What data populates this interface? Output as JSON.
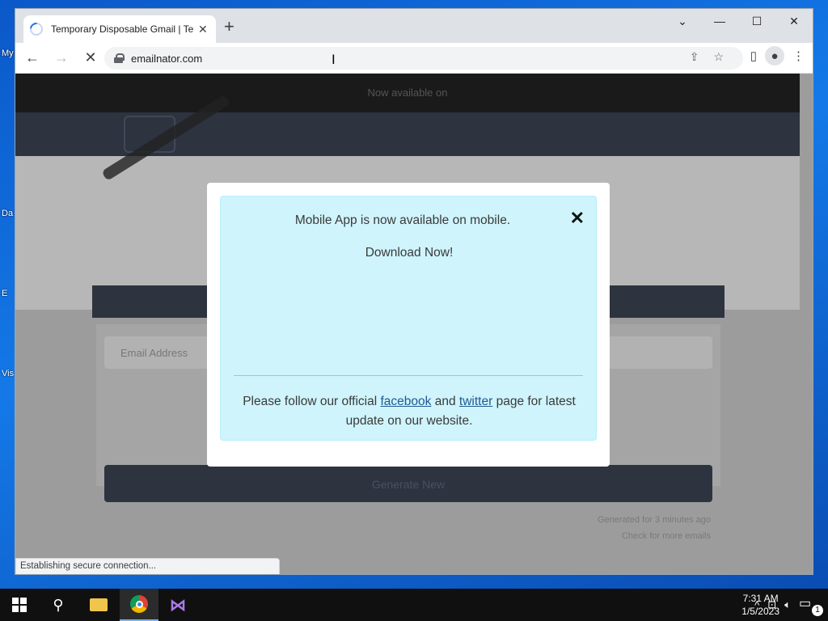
{
  "browser": {
    "tab_title": "Temporary Disposable Gmail | Temporary",
    "url": "emailnator.com",
    "status_text": "Establishing secure connection..."
  },
  "page": {
    "topbar_text": "Now available on",
    "input_placeholder": "Email Address",
    "generate_button": "Generate New",
    "footnote_1": "Generated for 3 minutes ago",
    "footnote_2": "Check for more emails"
  },
  "modal": {
    "line1": "Mobile App is now available on mobile.",
    "line2": "Download Now!",
    "follow_prefix": "Please follow our official",
    "facebook": "facebook",
    "and": "and",
    "twitter": "twitter",
    "follow_suffix": "page for latest update on our website."
  },
  "taskbar": {
    "time": "7:31 AM",
    "date": "1/5/2023",
    "notification_count": "1"
  },
  "desktop": {
    "labels": [
      "My",
      "Da",
      "E",
      "Vis"
    ]
  },
  "colors": {
    "accent": "#1a73e8",
    "alert_bg": "#cff4fc",
    "link": "#1f5a93"
  }
}
